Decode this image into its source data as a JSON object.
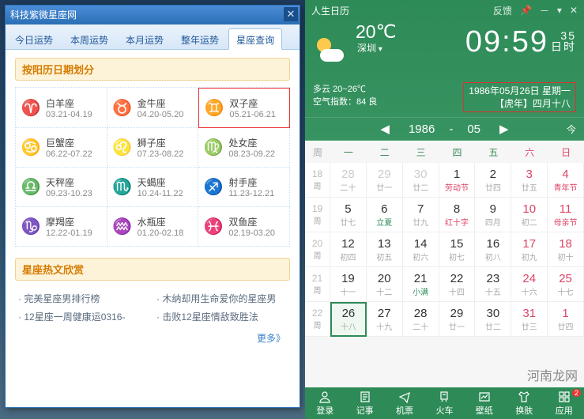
{
  "zodiac": {
    "window_title": "科技紫微星座网",
    "tabs": [
      "今日运势",
      "本周运势",
      "本月运势",
      "整年运势",
      "星座查询"
    ],
    "active_tab": 4,
    "section_title": "按阳历日期划分",
    "signs": [
      {
        "glyph": "♈",
        "name": "白羊座",
        "range": "03.21-04.19"
      },
      {
        "glyph": "♉",
        "name": "金牛座",
        "range": "04.20-05.20"
      },
      {
        "glyph": "♊",
        "name": "双子座",
        "range": "05.21-06.21",
        "hl": true
      },
      {
        "glyph": "♋",
        "name": "巨蟹座",
        "range": "06.22-07.22"
      },
      {
        "glyph": "♌",
        "name": "狮子座",
        "range": "07.23-08.22"
      },
      {
        "glyph": "♍",
        "name": "处女座",
        "range": "08.23-09.22"
      },
      {
        "glyph": "♎",
        "name": "天秤座",
        "range": "09.23-10.23"
      },
      {
        "glyph": "♏",
        "name": "天蝎座",
        "range": "10.24-11.22"
      },
      {
        "glyph": "♐",
        "name": "射手座",
        "range": "11.23-12.21"
      },
      {
        "glyph": "♑",
        "name": "摩羯座",
        "range": "12.22-01.19"
      },
      {
        "glyph": "♒",
        "name": "水瓶座",
        "range": "01.20-02.18"
      },
      {
        "glyph": "♓",
        "name": "双鱼座",
        "range": "02.19-03.20"
      }
    ],
    "hot_title": "星座热文欣赏",
    "hot_items": [
      "完美星座男排行榜",
      "木纳却用生命爱你的星座男",
      "12星座一周健康运0316-",
      "击败12星座情敌致胜法"
    ],
    "more": "更多》"
  },
  "calendar": {
    "app_title": "人生日历",
    "top_ctl": {
      "feedback": "反馈"
    },
    "weather": {
      "temp": "20℃",
      "city": "深圳",
      "cond": "多云 20~26℃",
      "aqi": "空气指数：84 良"
    },
    "clock": {
      "hhmm": "09:59",
      "sec": "35",
      "unit": "日时"
    },
    "date_line1": "1986年05月26日 星期一",
    "date_line2": "【虎年】四月十八",
    "nav": {
      "year": "1986",
      "month": "05",
      "today": "今"
    },
    "dow": [
      "一",
      "二",
      "三",
      "四",
      "五",
      "六",
      "日"
    ],
    "weeks": [
      {
        "wn": "18",
        "days": [
          {
            "d": "28",
            "l": "二十",
            "muted": true
          },
          {
            "d": "29",
            "l": "廿一",
            "muted": true
          },
          {
            "d": "30",
            "l": "廿二",
            "muted": true
          },
          {
            "d": "1",
            "l": "劳动节",
            "fest": true
          },
          {
            "d": "2",
            "l": "廿四"
          },
          {
            "d": "3",
            "l": "廿五",
            "weekend": true
          },
          {
            "d": "4",
            "l": "青年节",
            "weekend": true,
            "fest": true
          }
        ]
      },
      {
        "wn": "19",
        "days": [
          {
            "d": "5",
            "l": "廿七"
          },
          {
            "d": "6",
            "l": "立夏",
            "solar": true
          },
          {
            "d": "7",
            "l": "廿九"
          },
          {
            "d": "8",
            "l": "红十字",
            "fest": true
          },
          {
            "d": "9",
            "l": "四月"
          },
          {
            "d": "10",
            "l": "初二",
            "weekend": true
          },
          {
            "d": "11",
            "l": "母亲节",
            "weekend": true,
            "fest": true
          }
        ]
      },
      {
        "wn": "20",
        "days": [
          {
            "d": "12",
            "l": "初四"
          },
          {
            "d": "13",
            "l": "初五"
          },
          {
            "d": "14",
            "l": "初六"
          },
          {
            "d": "15",
            "l": "初七"
          },
          {
            "d": "16",
            "l": "初八"
          },
          {
            "d": "17",
            "l": "初九",
            "weekend": true
          },
          {
            "d": "18",
            "l": "初十",
            "weekend": true
          }
        ]
      },
      {
        "wn": "21",
        "days": [
          {
            "d": "19",
            "l": "十一"
          },
          {
            "d": "20",
            "l": "十二"
          },
          {
            "d": "21",
            "l": "小满",
            "solar": true
          },
          {
            "d": "22",
            "l": "十四"
          },
          {
            "d": "23",
            "l": "十五"
          },
          {
            "d": "24",
            "l": "十六",
            "weekend": true
          },
          {
            "d": "25",
            "l": "十七",
            "weekend": true
          }
        ]
      },
      {
        "wn": "22",
        "days": [
          {
            "d": "26",
            "l": "十八",
            "sel": true
          },
          {
            "d": "27",
            "l": "十九"
          },
          {
            "d": "28",
            "l": "二十"
          },
          {
            "d": "29",
            "l": "廿一"
          },
          {
            "d": "30",
            "l": "廿二"
          },
          {
            "d": "31",
            "l": "廿三",
            "weekend": true
          },
          {
            "d": "1",
            "l": "廿四",
            "muted": true,
            "weekend": true
          }
        ]
      }
    ],
    "bottom": [
      {
        "icon": "user",
        "label": "登录"
      },
      {
        "icon": "note",
        "label": "记事"
      },
      {
        "icon": "plane",
        "label": "机票"
      },
      {
        "icon": "train",
        "label": "火车"
      },
      {
        "icon": "pic",
        "label": "壁纸"
      },
      {
        "icon": "skin",
        "label": "换肤"
      },
      {
        "icon": "app",
        "label": "应用",
        "badge": "2"
      }
    ]
  },
  "watermark": "河南龙网"
}
